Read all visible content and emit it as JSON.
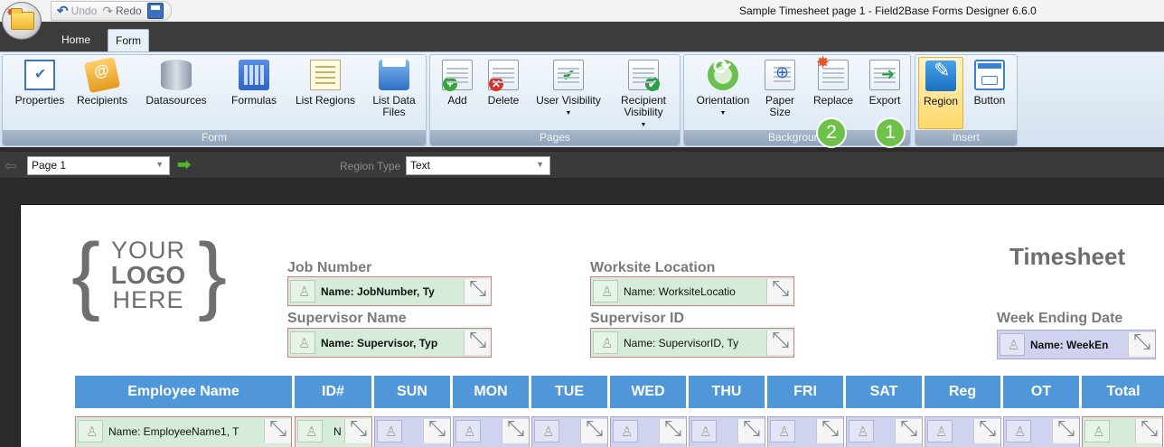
{
  "window": {
    "title": "Sample Timesheet page 1 - Field2Base Forms Designer 6.6.0",
    "qat": {
      "undo": "Undo",
      "redo": "Redo"
    }
  },
  "tabs": [
    {
      "label": "Home"
    },
    {
      "label": "Form",
      "active": true
    }
  ],
  "ribbon": {
    "groups": [
      {
        "label": "Form",
        "buttons": [
          "Properties",
          "Recipients",
          "Datasources",
          "Formulas",
          "List Regions",
          "List Data Files"
        ]
      },
      {
        "label": "Pages",
        "buttons": [
          "Add",
          "Delete",
          "User Visibility",
          "Recipient Visibility"
        ]
      },
      {
        "label": "Background",
        "buttons": [
          "Orientation",
          "Paper Size",
          "Replace",
          "Export"
        ]
      },
      {
        "label": "Insert",
        "buttons": [
          "Region",
          "Button"
        ],
        "active": "Region"
      }
    ],
    "callouts": [
      "2",
      "1"
    ]
  },
  "pagebar": {
    "page": "Page 1",
    "region_type_label": "Region Type",
    "region_type": "Text"
  },
  "sheet": {
    "logo": [
      "YOUR",
      "LOGO",
      "HERE"
    ],
    "title": "Timesheet",
    "fields": [
      {
        "label": "Job Number",
        "region": "Name: JobNumber, Ty"
      },
      {
        "label": "Supervisor Name",
        "region": "Name: Supervisor, Typ"
      },
      {
        "label": "Worksite Location",
        "region": "Name: WorksiteLocatio"
      },
      {
        "label": "Supervisor ID",
        "region": "Name: SupervisorID, Ty"
      },
      {
        "label": "Week Ending Date",
        "region": "Name: WeekEn"
      }
    ],
    "columns": [
      "Employee Name",
      "ID#",
      "SUN",
      "MON",
      "TUE",
      "WED",
      "THU",
      "FRI",
      "SAT",
      "Reg",
      "OT",
      "Total"
    ],
    "row1": {
      "employee": "Name: EmployeeName1, T",
      "id": "N"
    }
  }
}
